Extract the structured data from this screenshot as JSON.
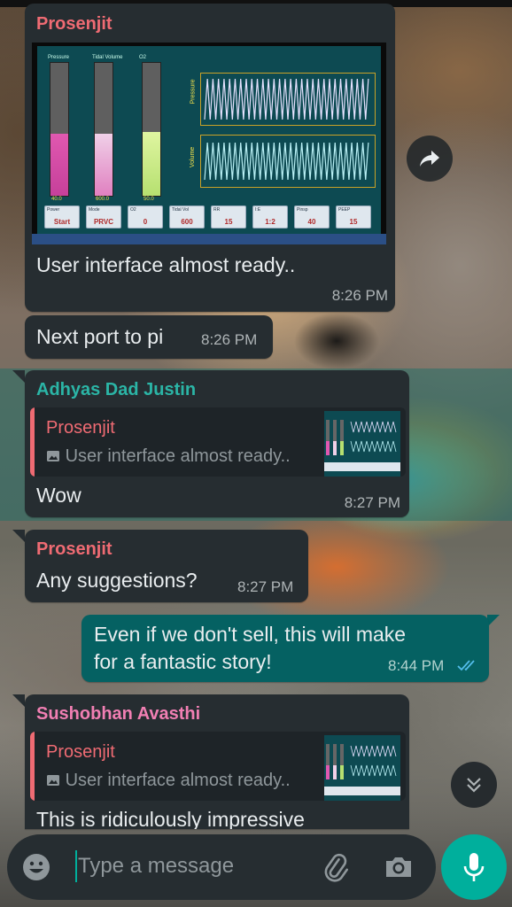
{
  "messages": [
    {
      "sender": "Prosenjit",
      "sender_color": "#ef6b73",
      "text": "User interface almost ready..",
      "time": "8:26 PM",
      "screenshot": {
        "gauges": [
          "Pressure",
          "Tidal Volume",
          "O2"
        ],
        "gauge_values": [
          "40.0",
          "600.0",
          "50.0"
        ],
        "plot_labels": [
          "Pressure",
          "Volume"
        ],
        "x_ticks": [
          "0",
          "5",
          "10",
          "15",
          "20",
          "25",
          "30"
        ],
        "buttons": [
          {
            "label": "Power",
            "value": "Start"
          },
          {
            "label": "Mode",
            "value": "PRVC"
          },
          {
            "label": "O2",
            "value": "0"
          },
          {
            "label": "Tidal Vol",
            "value": "600"
          },
          {
            "label": "RR",
            "value": "15"
          },
          {
            "label": "I:E",
            "value": "1:2"
          },
          {
            "label": "Pinsp",
            "value": "40"
          },
          {
            "label": "PEEP",
            "value": "15"
          }
        ]
      }
    },
    {
      "text": "Next port to pi",
      "time": "8:26 PM"
    },
    {
      "sender": "Adhyas Dad Justin",
      "sender_color": "#2bb5a6",
      "quote": {
        "name": "Prosenjit",
        "name_color": "#ef6b73",
        "text": "User interface almost ready.."
      },
      "text": "Wow",
      "time": "8:27 PM"
    },
    {
      "sender": "Prosenjit",
      "sender_color": "#ef6b73",
      "text": "Any suggestions?",
      "time": "8:27 PM"
    },
    {
      "outgoing": true,
      "text_line1": "Even if we don't sell, this will make",
      "text_line2": "for a fantastic story!",
      "time": "8:44 PM"
    },
    {
      "sender": "Sushobhan Avasthi",
      "sender_color": "#f17fb3",
      "quote": {
        "name": "Prosenjit",
        "name_color": "#ef6b73",
        "text": "User interface almost ready.."
      },
      "text": "This is ridiculously impressive"
    }
  ],
  "composer": {
    "placeholder": "Type a message"
  },
  "icons": {
    "forward": "forward-arrow-icon",
    "scroll_down": "double-chevron-down-icon",
    "emoji": "emoji-icon",
    "attach": "paperclip-icon",
    "camera": "camera-icon",
    "mic": "microphone-icon",
    "read": "double-check-icon",
    "image": "image-icon"
  },
  "colors": {
    "incoming_bubble": "#262d31",
    "outgoing_bubble": "#056162",
    "accent": "#00af9c",
    "read_receipt": "#53bdeb"
  }
}
